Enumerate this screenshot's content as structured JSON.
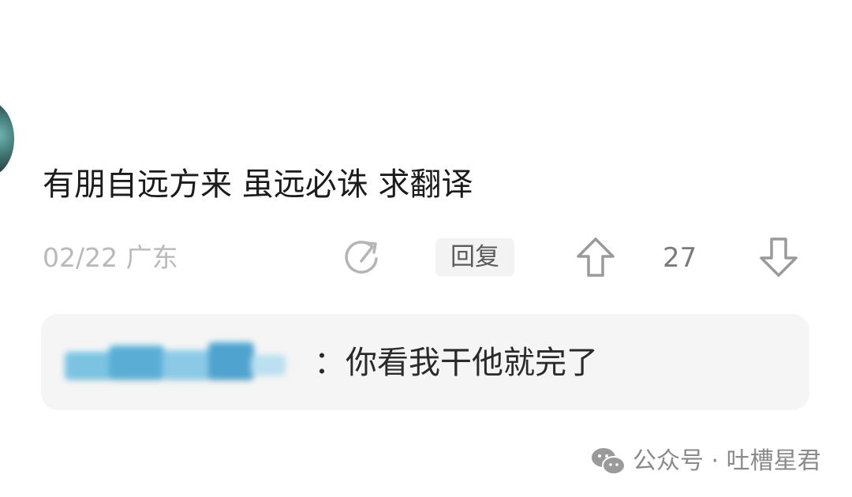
{
  "comment": {
    "text": "有朋自远方来 虽远必诛 求翻译",
    "date_location": "02/22 广东",
    "reply_label": "回复",
    "vote_count": "27"
  },
  "icons": {
    "share": "share-icon",
    "upvote": "upvote-arrow-icon",
    "downvote": "downvote-arrow-icon",
    "wechat": "wechat-icon"
  },
  "reply_preview": {
    "text": "：你看我干他就完了"
  },
  "watermark": {
    "text": "公众号 · 吐槽星君"
  },
  "colors": {
    "text_primary": "#1b1b1b",
    "text_meta": "#b9b9b9",
    "reply_bg": "#f5f5f5",
    "blurred_name": "#5fb0d6"
  }
}
